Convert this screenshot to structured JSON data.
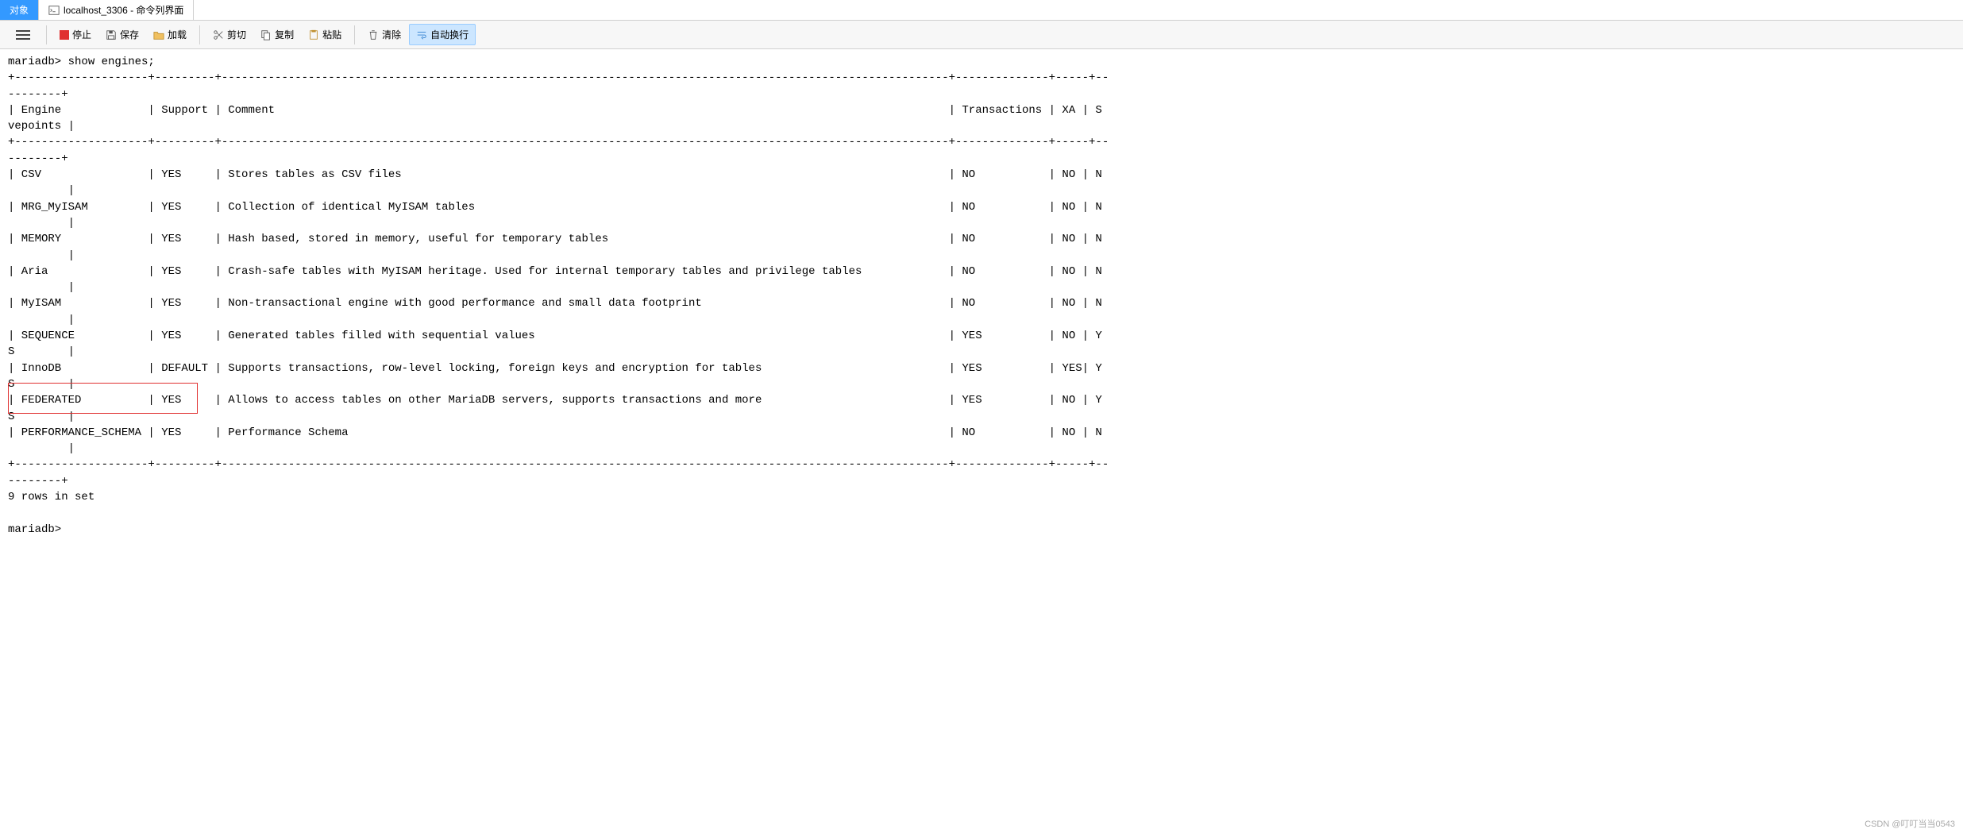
{
  "tabs": [
    {
      "label": "对象"
    },
    {
      "label": "localhost_3306 - 命令列界面"
    }
  ],
  "toolbar": {
    "stop": "停止",
    "save": "保存",
    "load": "加载",
    "cut": "剪切",
    "copy": "复制",
    "paste": "粘贴",
    "clear": "清除",
    "wrap": "自动换行"
  },
  "terminal": {
    "prompt": "mariadb> show engines;",
    "headers": {
      "engine": "Engine",
      "support": "Support",
      "comment": "Comment",
      "transactions": "Transactions",
      "xa": "XA",
      "savepoints_wrap": "vepoints |"
    },
    "rows": [
      {
        "engine": "CSV",
        "support": "YES",
        "comment": "Stores tables as CSV files",
        "transactions": "NO",
        "xa": "NO",
        "tail": "N"
      },
      {
        "engine": "MRG_MyISAM",
        "support": "YES",
        "comment": "Collection of identical MyISAM tables",
        "transactions": "NO",
        "xa": "NO",
        "tail": "N"
      },
      {
        "engine": "MEMORY",
        "support": "YES",
        "comment": "Hash based, stored in memory, useful for temporary tables",
        "transactions": "NO",
        "xa": "NO",
        "tail": "N"
      },
      {
        "engine": "Aria",
        "support": "YES",
        "comment": "Crash-safe tables with MyISAM heritage. Used for internal temporary tables and privilege tables",
        "transactions": "NO",
        "xa": "NO",
        "tail": "N"
      },
      {
        "engine": "MyISAM",
        "support": "YES",
        "comment": "Non-transactional engine with good performance and small data footprint",
        "transactions": "NO",
        "xa": "NO",
        "tail": "N"
      },
      {
        "engine": "SEQUENCE",
        "support": "YES",
        "comment": "Generated tables filled with sequential values",
        "transactions": "YES",
        "xa": "NO",
        "tail": "Y",
        "wrap": "S"
      },
      {
        "engine": "InnoDB",
        "support": "DEFAULT",
        "comment": "Supports transactions, row-level locking, foreign keys and encryption for tables",
        "transactions": "YES",
        "xa": "YES",
        "tail": "Y",
        "wrap": "S"
      },
      {
        "engine": "FEDERATED",
        "support": "YES",
        "comment": "Allows to access tables on other MariaDB servers, supports transactions and more",
        "transactions": "YES",
        "xa": "NO",
        "tail": "Y",
        "wrap": "S"
      },
      {
        "engine": "PERFORMANCE_SCHEMA",
        "support": "YES",
        "comment": "Performance Schema",
        "transactions": "NO",
        "xa": "NO",
        "tail": "N"
      }
    ],
    "footer": "9 rows in set",
    "prompt2": "mariadb>"
  },
  "watermark": "CSDN @叮叮当当0543"
}
